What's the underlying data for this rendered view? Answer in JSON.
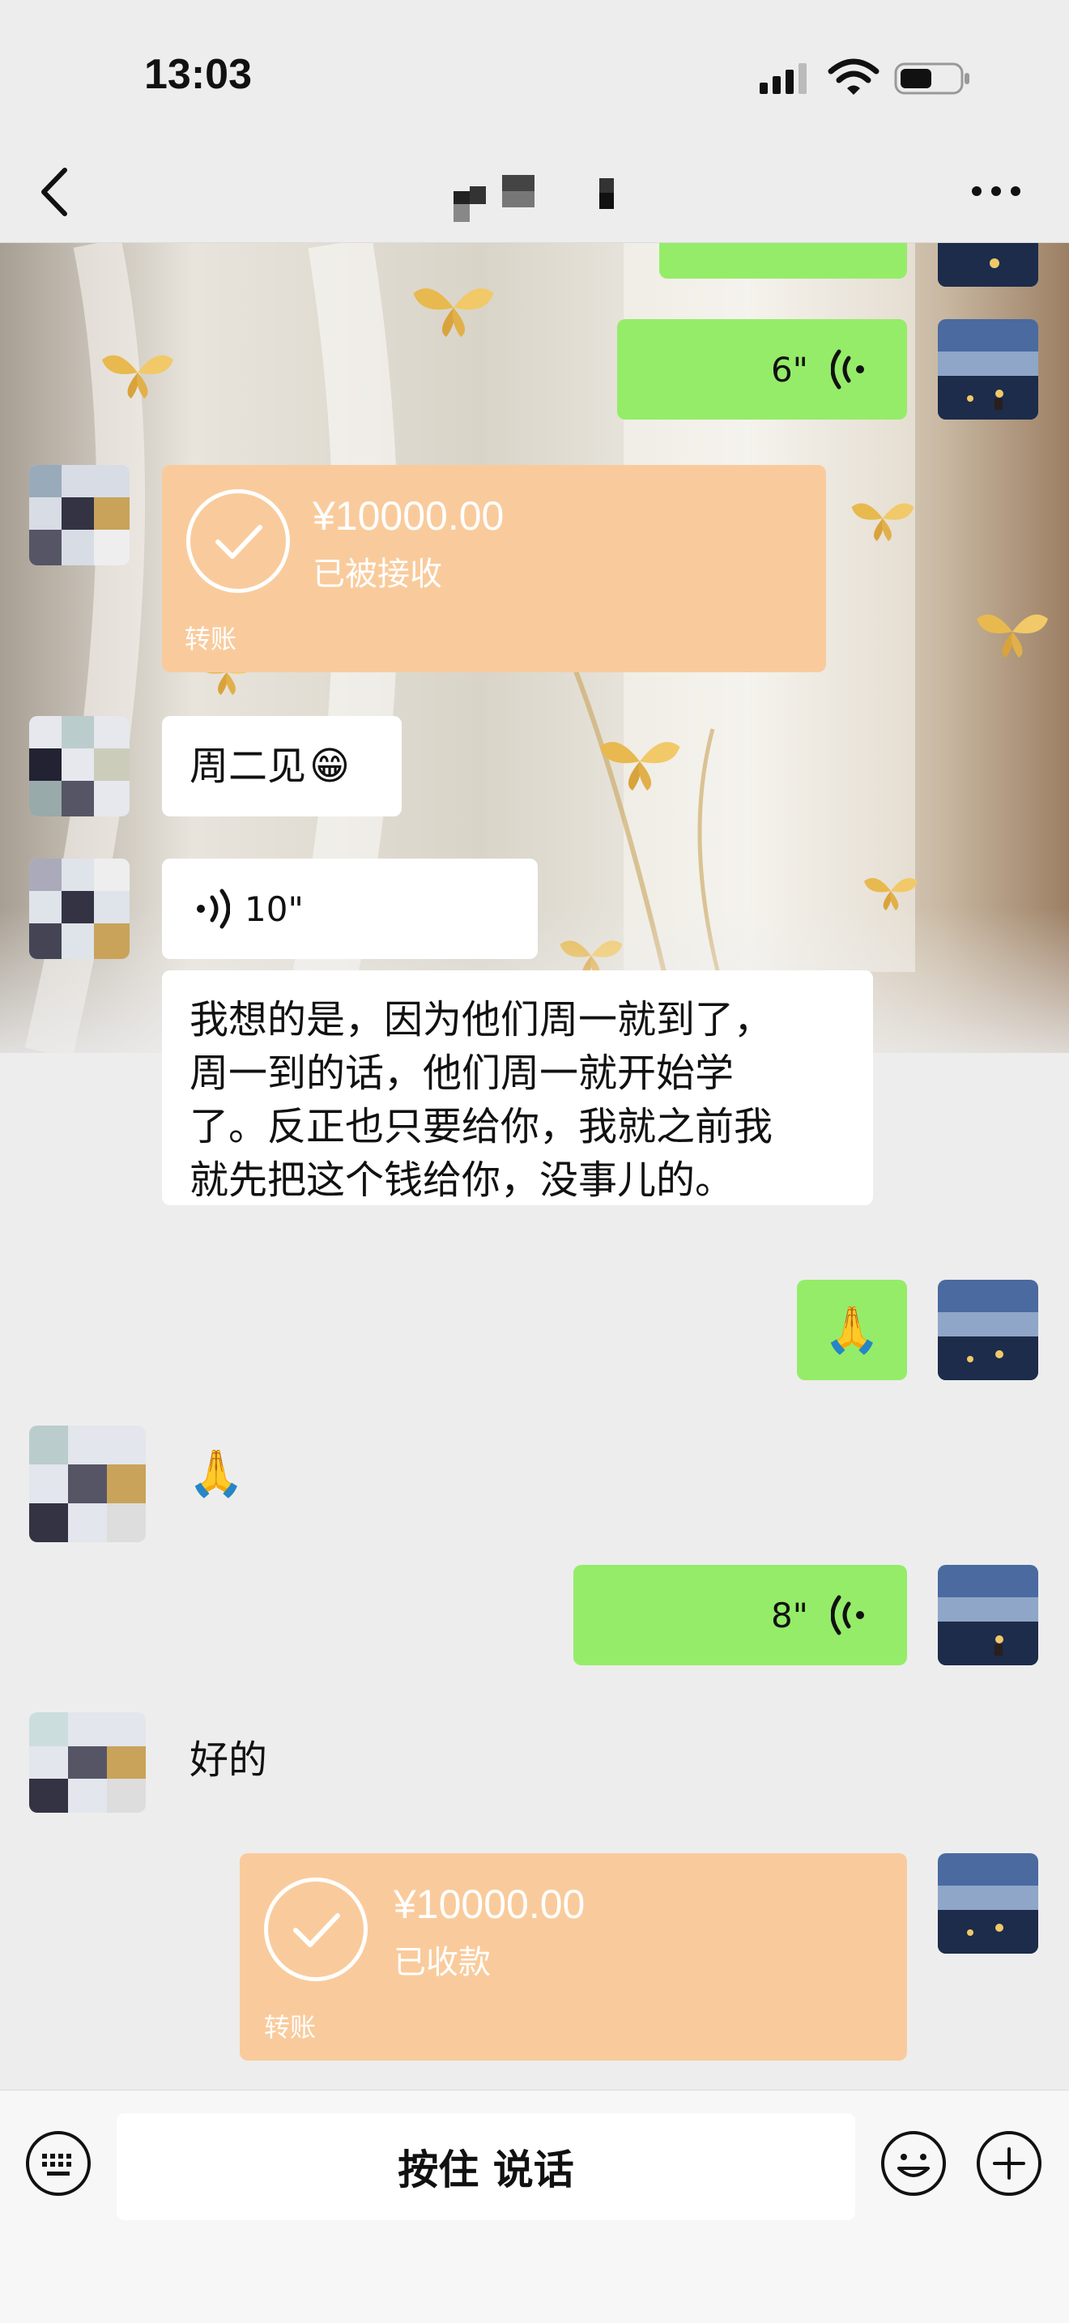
{
  "status_bar": {
    "time": "13:03"
  },
  "nav": {
    "back_icon": "chevron-left-icon",
    "more_icon": "more-dots-icon"
  },
  "messages": {
    "m0": {
      "side": "out",
      "type": "voice"
    },
    "m1": {
      "side": "out",
      "type": "voice",
      "duration": "6\""
    },
    "m2": {
      "side": "in",
      "type": "transfer",
      "amount": "¥10000.00",
      "status": "已被接收",
      "label": "转账"
    },
    "m3": {
      "side": "in",
      "type": "text",
      "text": "周二见",
      "emoji": "😁"
    },
    "m4": {
      "side": "in",
      "type": "voice",
      "duration": "10\""
    },
    "m5": {
      "side": "in",
      "type": "text",
      "lines": [
        "我想的是，因为他们周一就到了，",
        "周一到的话，他们周一就开始学",
        "了。反正也只要给你，我就之前我",
        "就先把这个钱给你，没事儿的。"
      ]
    },
    "m6": {
      "side": "out",
      "type": "emoji",
      "emoji": "🙏"
    },
    "m7": {
      "side": "in",
      "type": "emoji",
      "emoji": "🙏"
    },
    "m8": {
      "side": "out",
      "type": "voice",
      "duration": "8\""
    },
    "m9": {
      "side": "in",
      "type": "text",
      "text": "好的"
    },
    "m10": {
      "side": "out",
      "type": "transfer",
      "amount": "¥10000.00",
      "status": "已收款",
      "label": "转账"
    }
  },
  "input_bar": {
    "talk_label": "按住 说话"
  },
  "colors": {
    "out_bubble": "#95ec69",
    "in_bubble": "#ffffff",
    "transfer": "#f9cb9c",
    "background": "#ededed"
  }
}
